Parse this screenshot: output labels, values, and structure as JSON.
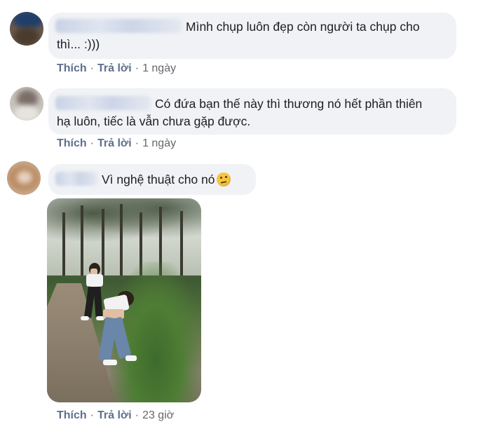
{
  "comments": [
    {
      "text_line1": "Mình chụp luôn đẹp còn người ta chụp cho",
      "text_line2": "thì... :)))",
      "actions": {
        "like": "Thích",
        "reply": "Trả lời",
        "time": "1 ngày"
      }
    },
    {
      "text_line1": "Có đứa bạn thế này thì thương nó hết phần thiên",
      "text_line2": "hạ luôn, tiếc là vẫn chưa gặp được.",
      "actions": {
        "like": "Thích",
        "reply": "Trả lời",
        "time": "1 ngày"
      }
    },
    {
      "text_line1": "Vì nghệ thuật cho nó",
      "emoji": "thinking-face-icon",
      "actions": {
        "like": "Thích",
        "reply": "Trả lời",
        "time": "23 giờ"
      }
    }
  ],
  "separator": "·",
  "colors": {
    "bubble": "#f0f2f5",
    "action_link": "#5e6f8e",
    "meta_text": "#65676b"
  }
}
